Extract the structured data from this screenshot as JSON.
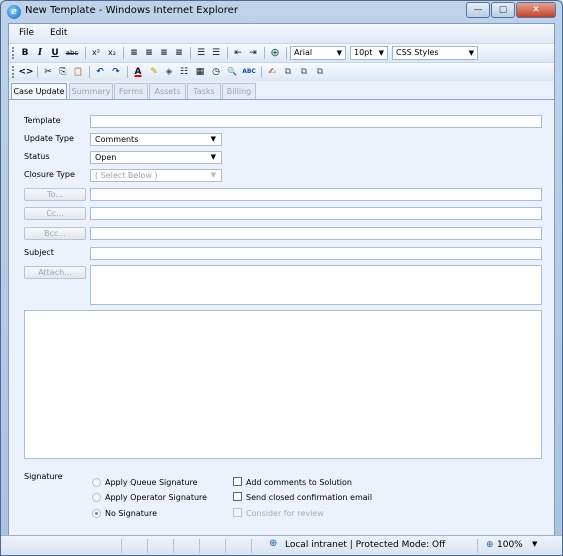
{
  "window": {
    "title": "New Template - Windows Internet Explorer"
  },
  "menu": [
    "File",
    "Edit"
  ],
  "toolbar1": {
    "buttons": [
      "B",
      "I",
      "U",
      "abc",
      "x²",
      "x₂",
      "≡",
      "≡",
      "≡",
      "≡",
      "☰",
      "☰",
      "⇤",
      "⇥",
      "⊕"
    ],
    "font": "Arial",
    "size": "10pt",
    "style": "CSS Styles"
  },
  "toolbar2": {
    "buttons": [
      "<>",
      "✂",
      "⎘",
      "📋",
      "↶",
      "↷",
      "A",
      "✎",
      "◈",
      "☷",
      "▦",
      "◷",
      "🔍",
      "ABC",
      "✍",
      "⧉",
      "⧉",
      "⧉"
    ]
  },
  "tabs": [
    "Case Update",
    "Summary",
    "Forms",
    "Assets",
    "Tasks",
    "Billing"
  ],
  "form": {
    "template_label": "Template",
    "template_value": "",
    "update_type_label": "Update Type",
    "update_type_value": "Comments",
    "status_label": "Status",
    "status_value": "Open",
    "closure_type_label": "Closure Type",
    "closure_type_value": "( Select Below )",
    "to_label": "To...",
    "cc_label": "Cc...",
    "bcc_label": "Bcc...",
    "subject_label": "Subject",
    "attach_label": "Attach...",
    "signature_label": "Signature",
    "radio_queue": "Apply Queue Signature",
    "radio_operator": "Apply Operator Signature",
    "radio_none": "No Signature",
    "check_add_comments": "Add comments to Solution",
    "check_send_closed": "Send closed confirmation email",
    "check_consider": "Consider for review"
  },
  "statusbar": {
    "zone": "Local intranet | Protected Mode: Off",
    "zoom": "100%"
  }
}
